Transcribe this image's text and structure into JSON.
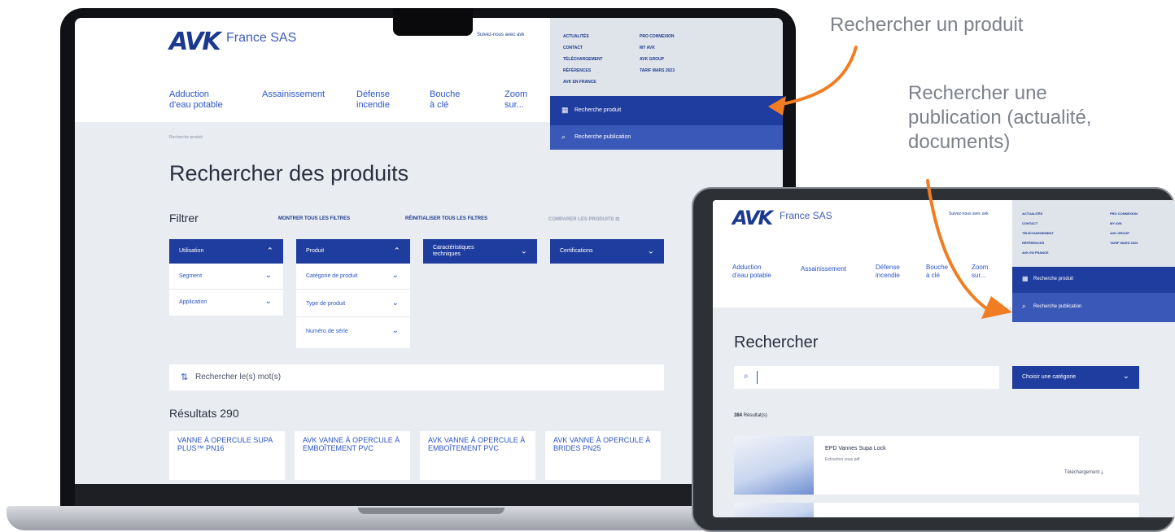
{
  "annotations": {
    "search_product": "Rechercher un produit",
    "search_publication_lines": [
      "Rechercher une",
      "publication (actualité,",
      "documents)"
    ],
    "arrow_color": "#f07d22"
  },
  "laptop": {
    "logo": "AVK",
    "logo_sub": "France SAS",
    "phone": "Suivez-nous avec avk",
    "nav": [
      "Adduction\nd'eau potable",
      "Assainissement",
      "Défense\nincendie",
      "Bouche\nà clé",
      "Zoom\nsur..."
    ],
    "utility_left": [
      "Actualités",
      "Contact",
      "Téléchargement",
      "Références",
      "AVK en France"
    ],
    "utility_right": [
      "Pro connexion",
      "My AVK",
      "AVK Group",
      "Tarif mars 2023"
    ],
    "btn_product": "Recherche produit",
    "btn_publication": "Recherche publication",
    "breadcrumb": "Recherche produit",
    "page_title": "Rechercher des produits",
    "filter_label": "Filtrer",
    "show_filters": "Montrer tous les filtres",
    "reset_filters": "Réinitialiser tous les filtres",
    "compare": "Comparer les produits",
    "filters": {
      "utilisation": "Utilisation",
      "segment": "Segment",
      "application": "Application",
      "produit": "Produit",
      "categorie": "Catégorie de produit",
      "type": "Type de produit",
      "numero": "Numéro de série",
      "caracteristiques": "Caractéristiques techniques",
      "certifications": "Certifications"
    },
    "search_placeholder": "Rechercher le(s) mot(s)",
    "results": "Résultats 290",
    "cards": [
      "VANNE À OPERCULE SUPA PLUS™ PN16",
      "AVK VANNE À OPERCULE À EMBOÎTEMENT PVC",
      "AVK VANNE À OPERCULE À EMBOÎTEMENT PVC",
      "AVK VANNE À OPERCULE À BRIDES PN25"
    ]
  },
  "tablet": {
    "logo": "AVK",
    "logo_sub": "France SAS",
    "phone": "Suivez-nous avec avk",
    "nav": [
      "Adduction\nd'eau potable",
      "Assainissement",
      "Défense\nincendie",
      "Bouche\nà clé",
      "Zoom\nsur..."
    ],
    "utility_left": [
      "Actualités",
      "Contact",
      "Téléchargement",
      "Références",
      "AVK en France"
    ],
    "utility_right": [
      "Pro connexion",
      "My AVK",
      "AVK Group",
      "Tarif mars 2023"
    ],
    "btn_product": "Recherche produit",
    "btn_publication": "Recherche publication",
    "page_title": "Rechercher",
    "select_category": "Choisir une catégorie",
    "count_number": "384",
    "count_label": "Résultat(s)",
    "doc_title": "EPD Vannes Supa Lock",
    "doc_sub": "Extraction vous pdf",
    "doc_download": "Téléchargement"
  }
}
